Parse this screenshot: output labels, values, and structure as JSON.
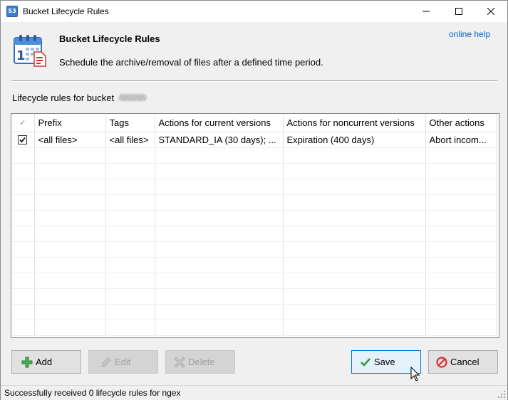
{
  "window": {
    "title": "Bucket Lifecycle Rules",
    "app_icon_text": "S3"
  },
  "header": {
    "title": "Bucket Lifecycle Rules",
    "description": "Schedule the archive/removal of files after a defined time period.",
    "online_help": "online help"
  },
  "bucket_label": "Lifecycle rules for bucket",
  "grid": {
    "columns": [
      "✓",
      "Prefix",
      "Tags",
      "Actions for current versions",
      "Actions for noncurrent versions",
      "Other actions"
    ],
    "rows": [
      {
        "checked": true,
        "prefix": "<all files>",
        "tags": "<all files>",
        "current": "STANDARD_IA (30 days); ...",
        "noncurrent": "Expiration (400 days)",
        "other": "Abort incom..."
      }
    ]
  },
  "buttons": {
    "add": "Add",
    "edit": "Edit",
    "delete": "Delete",
    "save": "Save",
    "cancel": "Cancel"
  },
  "status": "Successfully received 0 lifecycle rules for ngex",
  "colors": {
    "link": "#0066cc",
    "focus_border": "#0078d7",
    "add_icon": "#4caf50",
    "cancel_icon": "#d9302c"
  },
  "icons": [
    "minimize-icon",
    "maximize-icon",
    "close-icon",
    "calendar-icon",
    "plus-icon",
    "pencil-icon",
    "delete-x-icon",
    "checkmark-icon",
    "cancel-icon",
    "mouse-cursor-icon",
    "resize-grip-icon"
  ]
}
